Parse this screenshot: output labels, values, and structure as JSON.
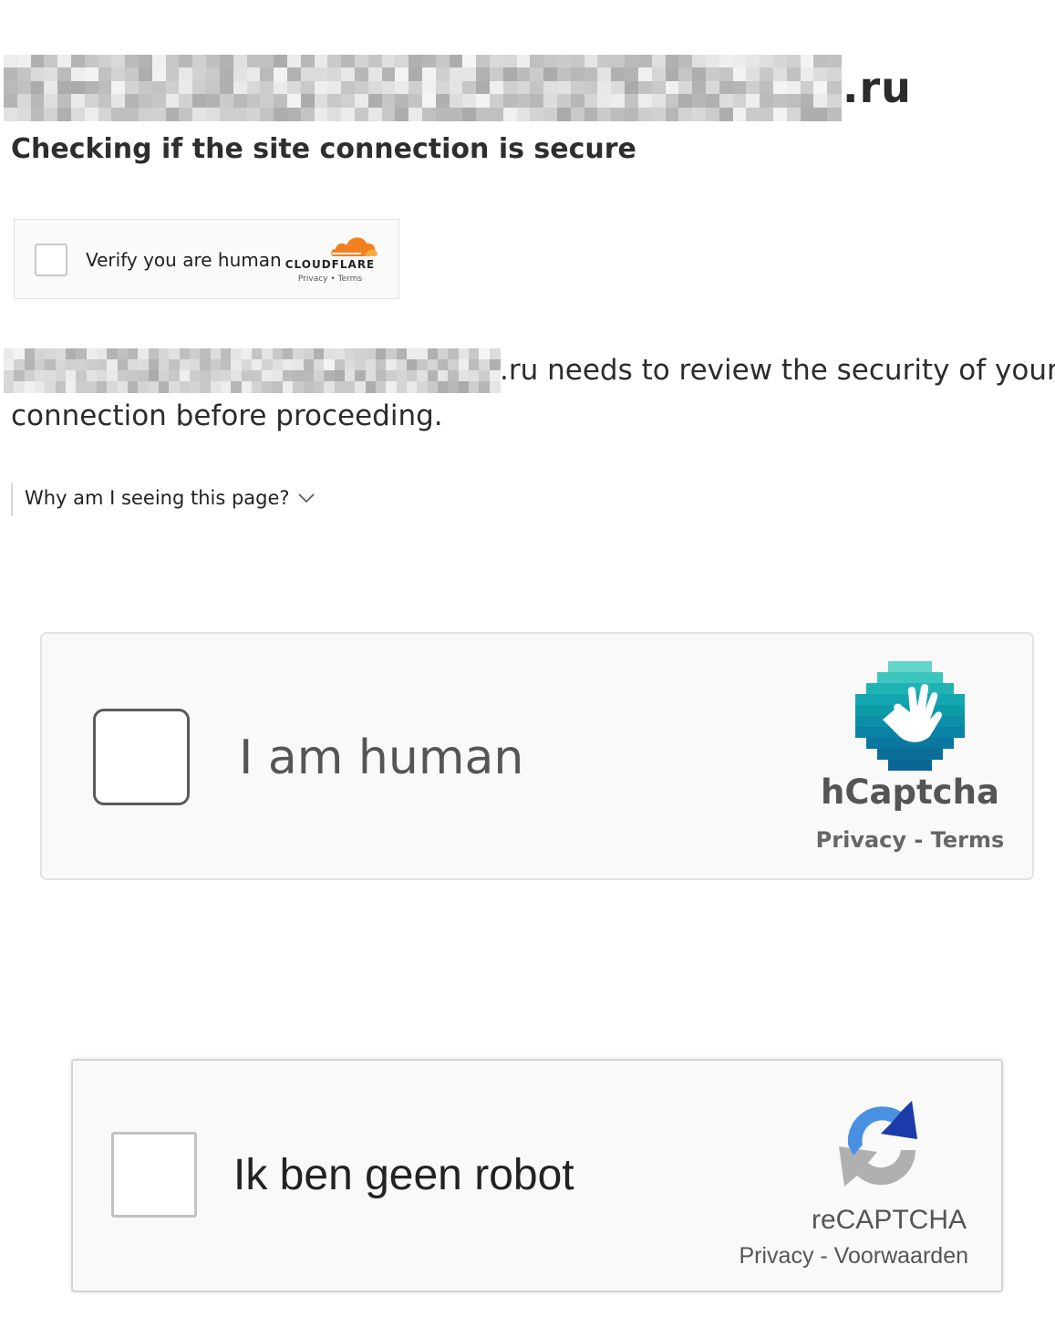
{
  "header": {
    "domain_tld": ".ru",
    "heading": "Checking if the site connection is secure"
  },
  "cloudflare": {
    "checkbox_label": "Verify you are human",
    "wordmark": "CLOUDFLARE",
    "privacy": "Privacy",
    "separator": "•",
    "terms": "Terms",
    "accent_color": "#f38020"
  },
  "security": {
    "line1_tail": ".ru needs to review the security of your",
    "line2": "connection before proceeding."
  },
  "why": {
    "link_label": "Why am I seeing this page?",
    "icon": "chevron-down-icon"
  },
  "hcaptcha": {
    "checkbox_label": "I am human",
    "brand": "hCaptcha",
    "privacy": "Privacy",
    "separator": " - ",
    "terms": "Terms",
    "logo_color": "#0e9ba8"
  },
  "recaptcha": {
    "checkbox_label": "Ik ben geen robot",
    "brand": "reCAPTCHA",
    "privacy": "Privacy",
    "separator": " - ",
    "terms": "Voorwaarden",
    "blue": "#4a90e2",
    "dark_blue": "#1c3aa9",
    "grey": "#b0b0b0"
  }
}
